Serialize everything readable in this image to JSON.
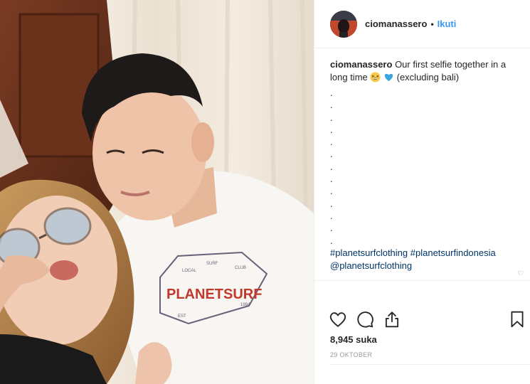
{
  "post": {
    "username": "ciomanassero",
    "separator": "•",
    "follow_label": "Ikuti",
    "caption": {
      "username": "ciomanassero",
      "text": "Our first selfie together in a long time",
      "emojis": [
        "grinning-squinting-face",
        "blue-heart"
      ],
      "after_emoji": "(excluding bali)",
      "dots": [
        ".",
        ".",
        ".",
        ".",
        ".",
        ".",
        ".",
        ".",
        ".",
        ".",
        ".",
        ".",
        "."
      ],
      "hashtags": [
        "#planetsurfclothing",
        "#planetsurfindonesia"
      ],
      "mention": "@planetsurfclothing"
    },
    "likes_label": "8,945 suka",
    "date": "29 OKTOBER"
  },
  "photo": {
    "shirt_brand": "PLANETSURF",
    "badge_top": "SURF",
    "badge_left": "LOCAL",
    "badge_right": "CLUB",
    "badge_bottom_left": "EST",
    "badge_bottom_right": "1994"
  },
  "icons": {
    "like": "heart-icon",
    "comment": "comment-icon",
    "share": "share-icon",
    "save": "bookmark-icon"
  },
  "colors": {
    "link": "#3897f0",
    "hashtag": "#003569",
    "text": "#262626",
    "muted": "#999999",
    "divider": "#efefef"
  }
}
